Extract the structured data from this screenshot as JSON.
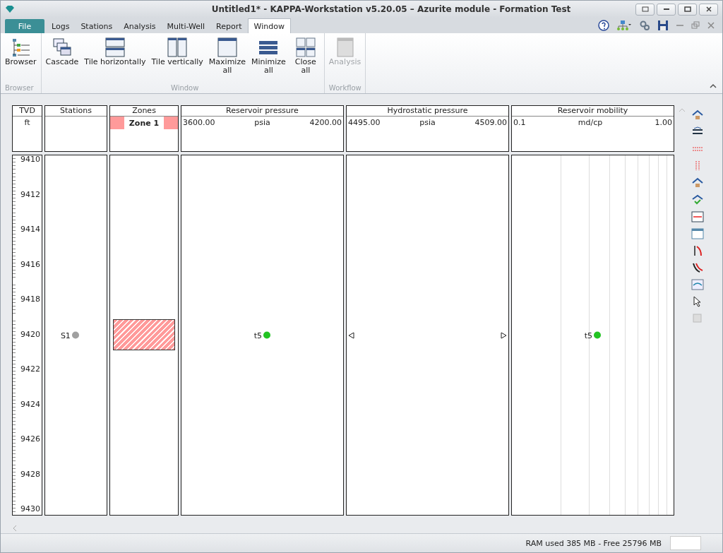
{
  "window": {
    "title": "Untitled1* - KAPPA-Workstation v5.20.05  – Azurite module - Formation Test"
  },
  "tabs": [
    {
      "label": "File",
      "kind": "file",
      "selected": false
    },
    {
      "label": "Logs",
      "kind": "tab",
      "selected": false
    },
    {
      "label": "Stations",
      "kind": "tab",
      "selected": false
    },
    {
      "label": "Analysis",
      "kind": "tab",
      "selected": false
    },
    {
      "label": "Multi-Well",
      "kind": "tab",
      "selected": false
    },
    {
      "label": "Report",
      "kind": "tab",
      "selected": false
    },
    {
      "label": "Window",
      "kind": "tab",
      "selected": true
    }
  ],
  "ribbon": [
    {
      "label": "Browser",
      "buttons": [
        {
          "label": "Browser",
          "kind": "browser",
          "disabled": false
        }
      ]
    },
    {
      "label": "Window",
      "buttons": [
        {
          "label": "Cascade",
          "kind": "cascade",
          "disabled": false
        },
        {
          "label": "Tile horizontally",
          "kind": "tileh",
          "disabled": false
        },
        {
          "label": "Tile vertically",
          "kind": "tilev",
          "disabled": false
        },
        {
          "label": "Maximize\nall",
          "kind": "max",
          "disabled": false
        },
        {
          "label": "Minimize\nall",
          "kind": "min",
          "disabled": false
        },
        {
          "label": "Close\nall",
          "kind": "close",
          "disabled": false
        }
      ]
    },
    {
      "label": "Workflow",
      "buttons": [
        {
          "label": "Analysis",
          "kind": "analysis",
          "disabled": true
        }
      ]
    }
  ],
  "depth_track": {
    "title": "TVD",
    "unit": "ft",
    "ticks": [
      "9410",
      "9412",
      "9414",
      "9416",
      "9418",
      "9420",
      "9422",
      "9424",
      "9426",
      "9428",
      "9430"
    ]
  },
  "tracks": [
    {
      "kind": "stations",
      "title": "Stations",
      "markers": [
        {
          "kind": "dot",
          "label": "S1",
          "color": "#a0a0a0"
        }
      ]
    },
    {
      "kind": "zones",
      "title": "Zones",
      "zone": {
        "label": "Zone 1",
        "color": "#ff9a9a"
      }
    },
    {
      "kind": "linear",
      "title": "Reservoir pressure",
      "min": "3600.00",
      "unit": "psia",
      "max": "4200.00",
      "markers": [
        {
          "kind": "dot",
          "label": "t5",
          "color": "#22c322"
        }
      ]
    },
    {
      "kind": "linear",
      "title": "Hydrostatic pressure",
      "min": "4495.00",
      "unit": "psia",
      "max": "4509.00",
      "markers": [
        {
          "kind": "left-triangle"
        },
        {
          "kind": "right-triangle"
        }
      ]
    },
    {
      "kind": "log",
      "title": "Reservoir mobility",
      "min": "0.1",
      "unit": "md/cp",
      "max": "1.00",
      "markers": [
        {
          "kind": "dot",
          "label": "t5",
          "color": "#22c322"
        }
      ]
    }
  ],
  "status_bar": {
    "memory": "RAM used 385 MB - Free 25796 MB"
  }
}
